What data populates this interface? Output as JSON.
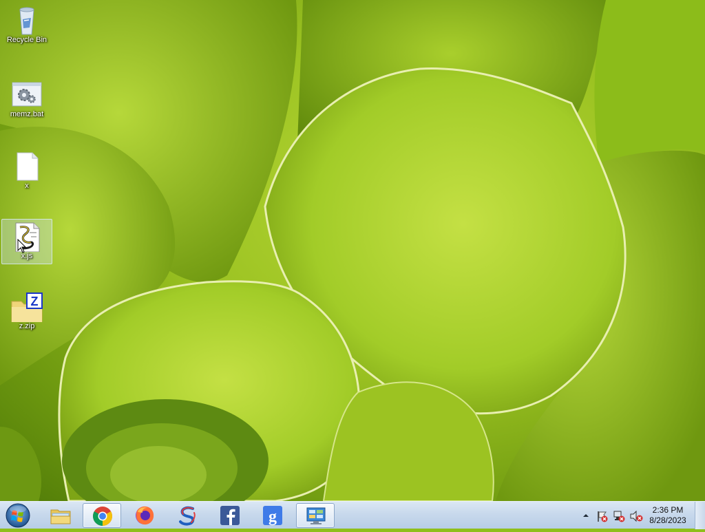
{
  "desktop": {
    "icons": [
      {
        "label": "Recycle Bin",
        "icon": "recycle-bin-icon"
      },
      {
        "label": "memz.bat",
        "icon": "batch-file-icon"
      },
      {
        "label": "x",
        "icon": "blank-file-icon"
      },
      {
        "label": "x.js",
        "icon": "script-file-icon"
      },
      {
        "label": "z.zip",
        "icon": "zip-folder-icon"
      }
    ],
    "selected_icon": "x.js"
  },
  "taskbar": {
    "start": {
      "icon": "windows-start-orb-icon"
    },
    "pinned": [
      {
        "icon": "file-explorer-icon"
      },
      {
        "icon": "chrome-icon"
      },
      {
        "icon": "firefox-icon"
      },
      {
        "icon": "app-s-icon"
      },
      {
        "icon": "facebook-icon"
      },
      {
        "icon": "google-icon"
      },
      {
        "icon": "control-panel-icon"
      }
    ],
    "active": [
      "chrome-icon",
      "control-panel-icon"
    ],
    "tray": {
      "icons": [
        "show-hidden-icons-chevron-icon",
        "action-center-flag-icon",
        "network-error-icon",
        "volume-muted-icon"
      ],
      "time": "2:36 PM",
      "date": "8/28/2023"
    }
  },
  "colors": {
    "wallpaper_main": "#9cc322",
    "taskbar": "#c8d9ec",
    "chrome_red": "#db4437",
    "chrome_yellow": "#f4c20d",
    "chrome_green": "#0f9d58",
    "chrome_blue": "#4285f4",
    "facebook_blue": "#3b5998"
  }
}
